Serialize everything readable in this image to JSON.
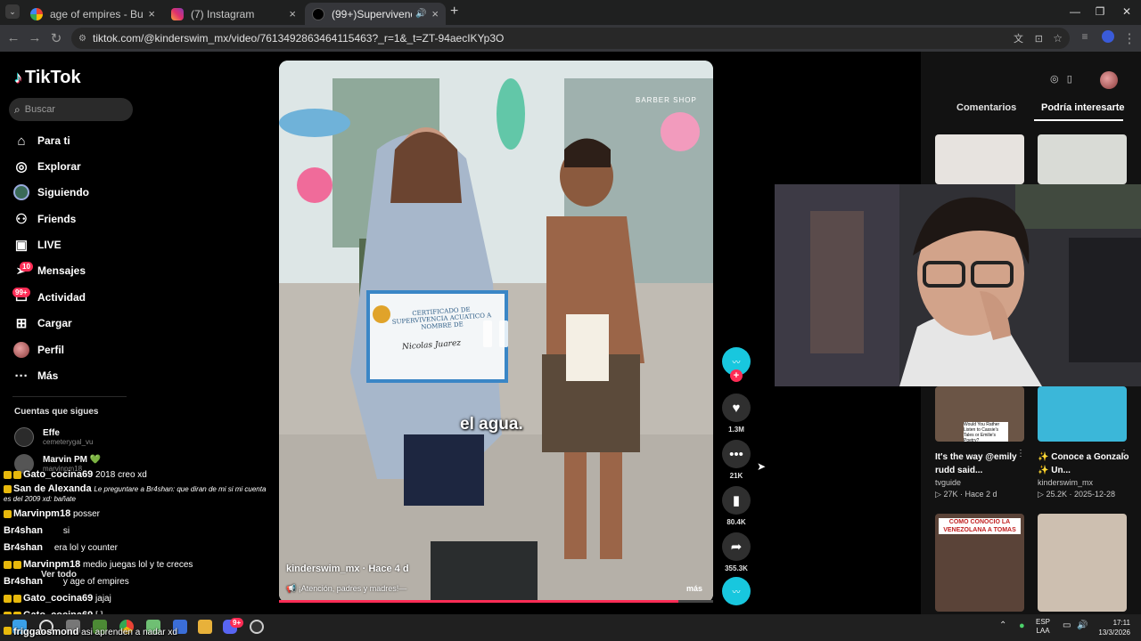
{
  "browser": {
    "tabs": [
      {
        "title": "age of empires - Buscar con Go",
        "close": "×"
      },
      {
        "title": "(7) Instagram",
        "close": "×"
      },
      {
        "title": "(99+)Supervivencia Acuátic",
        "close": "×"
      }
    ],
    "new_tab": "+",
    "url": "tiktok.com/@kinderswim_mx/video/7613492863464115463?_r=1&_t=ZT-94aecIKYp3O"
  },
  "tiktok": {
    "logo": "TikTok",
    "search_placeholder": "Buscar",
    "nav": [
      {
        "label": "Para ti",
        "icon": "home-icon"
      },
      {
        "label": "Explorar",
        "icon": "compass-icon"
      },
      {
        "label": "Siguiendo",
        "icon": "following-icon"
      },
      {
        "label": "Friends",
        "icon": "friends-icon"
      },
      {
        "label": "LIVE",
        "icon": "live-icon"
      },
      {
        "label": "Mensajes",
        "icon": "messages-icon",
        "badge": "10"
      },
      {
        "label": "Actividad",
        "icon": "activity-icon",
        "badge": "99+"
      },
      {
        "label": "Cargar",
        "icon": "upload-icon"
      },
      {
        "label": "Perfil",
        "icon": "profile-icon"
      },
      {
        "label": "Más",
        "icon": "more-icon"
      }
    ],
    "following_header": "Cuentas que sigues",
    "following": [
      {
        "name": "Effe",
        "handle": "cemeterygal_vu"
      },
      {
        "name": "Marvin PM 💚",
        "handle": "marvinpm18"
      }
    ],
    "see_all": "Ver todo"
  },
  "chat": [
    {
      "user": "Gato_cocina69",
      "msg": "2018 creo xd"
    },
    {
      "user": "San de Alexanda",
      "msg": "Le preguntare a Br4shan: que diran de mi si mi cuenta es del 2009 xd: bañate"
    },
    {
      "user": "Marvinpm18",
      "msg": "posser"
    },
    {
      "user": "Br4shan",
      "msg": "si"
    },
    {
      "user": "Br4shan",
      "msg": "era lol y counter"
    },
    {
      "user": "Marvinpm18",
      "msg": "medio juegas lol y te creces"
    },
    {
      "user": "Br4shan",
      "msg": "y age of empires"
    },
    {
      "user": "Gato_cocina69",
      "msg": "jajaj"
    },
    {
      "user": "Gato_cocina69",
      "msg": "[ ]"
    },
    {
      "user": "friggaosmond",
      "msg": "asi aprenden a nadar xd"
    }
  ],
  "video": {
    "caption": "el agua.",
    "author": "kinderswim_mx",
    "time": "Hace 4 d",
    "description": "¡Atención, padres y madres!—",
    "more": "más",
    "progress": 0.92,
    "certificate_title": "CERTIFICADO DE SUPERVIVENCIA ACUATICO A NOMBRE DE",
    "certificate_name": "Nicolas Juarez",
    "sign": "BARBER SHOP"
  },
  "actions": [
    {
      "icon": "heart-icon",
      "count": "1.3M"
    },
    {
      "icon": "comment-icon",
      "count": "21K"
    },
    {
      "icon": "bookmark-icon",
      "count": "80.4K"
    },
    {
      "icon": "share-icon",
      "count": "355.3K"
    }
  ],
  "right": {
    "tabs": [
      "Comentarios",
      "Podría interesarte"
    ],
    "recs": [
      {
        "title": "It's the way @emily rudd said...",
        "author": "tvguide",
        "stats": "27K · Hace 2 d"
      },
      {
        "title": "✨ Conoce a Gonzalo ✨ Un...",
        "author": "kinderswim_mx",
        "stats": "25.2K · 2025-12-28"
      }
    ],
    "thumb_texts": [
      "COMO CONOCIO LA VENEZOLANA A TOMAS",
      "Would You Rather Listen to Cassie's Tales or Emilie's Poetry?"
    ]
  },
  "taskbar": {
    "lang": "ESP",
    "region": "LAA",
    "time": "17:11",
    "date": "13/3/2026",
    "discord_badge": "9+"
  },
  "colors": {
    "accent": "#fe2c55",
    "tiktok_cyan": "#25f4ee",
    "bg": "#000000"
  }
}
